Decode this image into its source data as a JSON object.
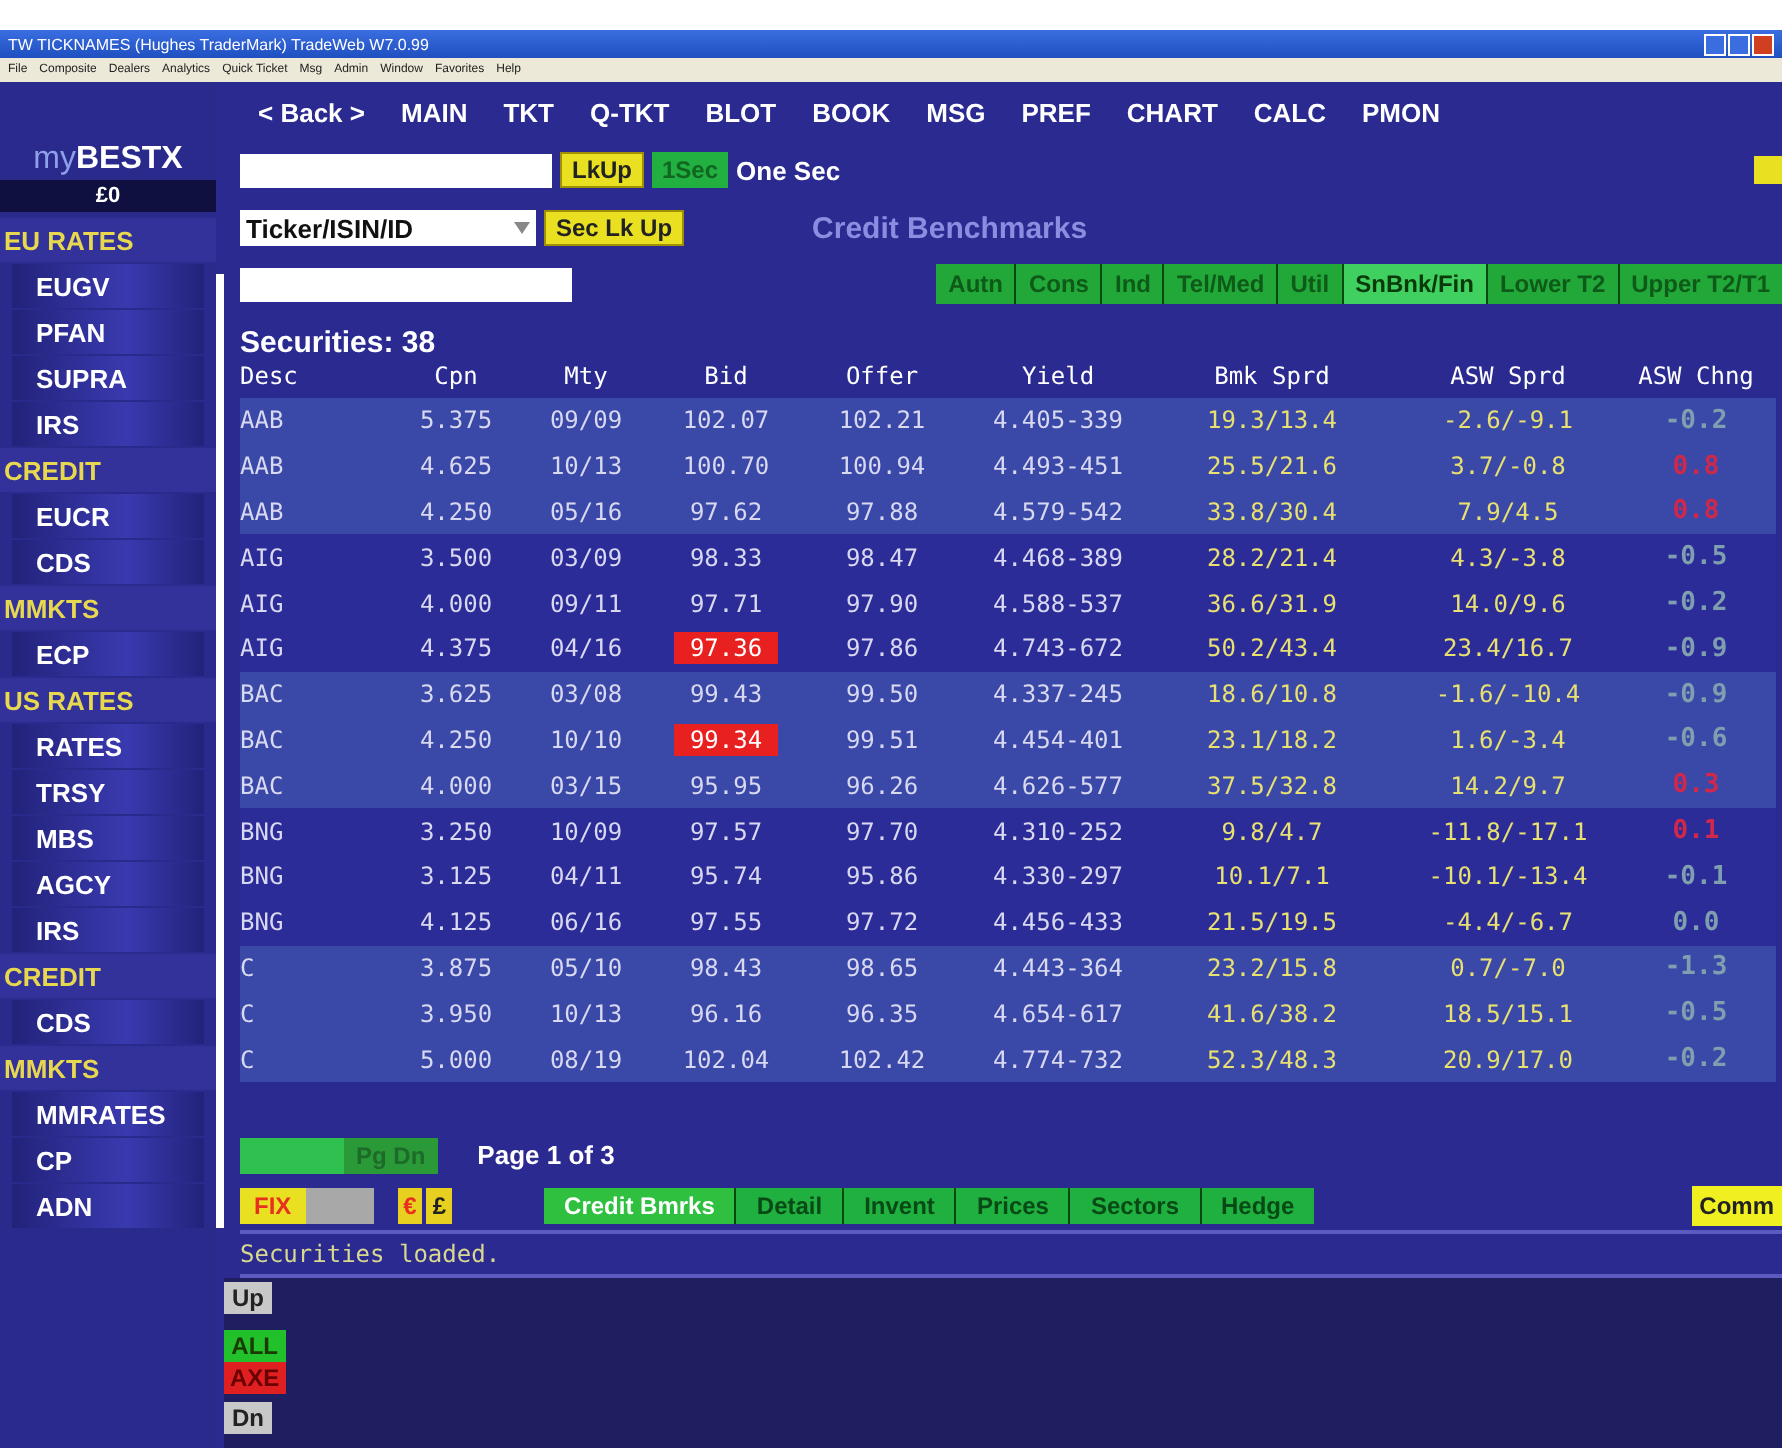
{
  "window": {
    "title": "TW TICKNAMES (Hughes TraderMark) TradeWeb W7.0.99",
    "menu": [
      "File",
      "Composite",
      "Dealers",
      "Analytics",
      "Quick Ticket",
      "Msg",
      "Admin",
      "Window",
      "Favorites",
      "Help"
    ]
  },
  "nav": [
    "< Back >",
    "MAIN",
    "TKT",
    "Q-TKT",
    "BLOT",
    "BOOK",
    "MSG",
    "PREF",
    "CHART",
    "CALC",
    "PMON"
  ],
  "brand": {
    "prefix": "my",
    "name": "BESTX",
    "balance": "£0"
  },
  "sidebar": [
    {
      "title": "EU RATES",
      "items": [
        "EUGV",
        "PFAN",
        "SUPRA",
        "IRS"
      ]
    },
    {
      "title": "CREDIT",
      "items": [
        "EUCR",
        "CDS"
      ]
    },
    {
      "title": "MMKTS",
      "items": [
        "ECP"
      ]
    },
    {
      "title": "US RATES",
      "items": [
        "RATES",
        "TRSY",
        "MBS",
        "AGCY",
        "IRS"
      ]
    },
    {
      "title": "CREDIT",
      "items": [
        "CDS"
      ]
    },
    {
      "title": "MMKTS",
      "items": [
        "MMRATES",
        "CP",
        "ADN"
      ]
    }
  ],
  "lookup": {
    "button": "LkUp",
    "toggle": "1Sec",
    "toggle_label": "One Sec"
  },
  "search": {
    "type_select": "Ticker/ISIN/ID",
    "button": "Sec Lk Up"
  },
  "panel_title": "Credit Benchmarks",
  "sector_tabs": [
    {
      "label": "Autn",
      "selected": false
    },
    {
      "label": "Cons",
      "selected": false
    },
    {
      "label": "Ind",
      "selected": false
    },
    {
      "label": "Tel/Med",
      "selected": false
    },
    {
      "label": "Util",
      "selected": false
    },
    {
      "label": "SnBnk/Fin",
      "selected": true
    },
    {
      "label": "Lower T2",
      "selected": false
    },
    {
      "label": "Upper T2/T1",
      "selected": false
    }
  ],
  "count": "Securities: 38",
  "table": {
    "columns": [
      "Desc",
      "Cpn",
      "Mty",
      "Bid",
      "Offer",
      "Yield",
      "Bmk Sprd",
      "ASW Sprd",
      "ASW Chng"
    ],
    "rows": [
      {
        "cells": [
          "AAB",
          "5.375",
          "09/09",
          "102.07",
          "102.21",
          "4.405-339",
          "19.3/13.4",
          "-2.6/-9.1",
          "-0.2"
        ],
        "shaded": true,
        "bid_alert": false,
        "color": "#7f9fb0"
      },
      {
        "cells": [
          "AAB",
          "4.625",
          "10/13",
          "100.70",
          "100.94",
          "4.493-451",
          "25.5/21.6",
          "3.7/-0.8",
          "0.8"
        ],
        "shaded": true,
        "bid_alert": false,
        "color": "#d0284a"
      },
      {
        "cells": [
          "AAB",
          "4.250",
          "05/16",
          "97.62",
          "97.88",
          "4.579-542",
          "33.8/30.4",
          "7.9/4.5",
          "0.8"
        ],
        "shaded": true,
        "bid_alert": false,
        "color": "#d0284a"
      },
      {
        "cells": [
          "AIG",
          "3.500",
          "03/09",
          "98.33",
          "98.47",
          "4.468-389",
          "28.2/21.4",
          "4.3/-3.8",
          "-0.5"
        ],
        "shaded": false,
        "bid_alert": false,
        "color": "#7f9fb0"
      },
      {
        "cells": [
          "AIG",
          "4.000",
          "09/11",
          "97.71",
          "97.90",
          "4.588-537",
          "36.6/31.9",
          "14.0/9.6",
          "-0.2"
        ],
        "shaded": false,
        "bid_alert": false,
        "color": "#7f9fb0"
      },
      {
        "cells": [
          "AIG",
          "4.375",
          "04/16",
          "97.36",
          "97.86",
          "4.743-672",
          "50.2/43.4",
          "23.4/16.7",
          "-0.9"
        ],
        "shaded": false,
        "bid_alert": true,
        "color": "#7f9fb0"
      },
      {
        "cells": [
          "BAC",
          "3.625",
          "03/08",
          "99.43",
          "99.50",
          "4.337-245",
          "18.6/10.8",
          "-1.6/-10.4",
          "-0.9"
        ],
        "shaded": true,
        "bid_alert": false,
        "color": "#7f9fb0"
      },
      {
        "cells": [
          "BAC",
          "4.250",
          "10/10",
          "99.34",
          "99.51",
          "4.454-401",
          "23.1/18.2",
          "1.6/-3.4",
          "-0.6"
        ],
        "shaded": true,
        "bid_alert": true,
        "color": "#7f9fb0"
      },
      {
        "cells": [
          "BAC",
          "4.000",
          "03/15",
          "95.95",
          "96.26",
          "4.626-577",
          "37.5/32.8",
          "14.2/9.7",
          "0.3"
        ],
        "shaded": true,
        "bid_alert": false,
        "color": "#d0284a"
      },
      {
        "cells": [
          "BNG",
          "3.250",
          "10/09",
          "97.57",
          "97.70",
          "4.310-252",
          "9.8/4.7",
          "-11.8/-17.1",
          "0.1"
        ],
        "shaded": false,
        "bid_alert": false,
        "color": "#d0284a"
      },
      {
        "cells": [
          "BNG",
          "3.125",
          "04/11",
          "95.74",
          "95.86",
          "4.330-297",
          "10.1/7.1",
          "-10.1/-13.4",
          "-0.1"
        ],
        "shaded": false,
        "bid_alert": false,
        "color": "#7f9fb0"
      },
      {
        "cells": [
          "BNG",
          "4.125",
          "06/16",
          "97.55",
          "97.72",
          "4.456-433",
          "21.5/19.5",
          "-4.4/-6.7",
          "0.0"
        ],
        "shaded": false,
        "bid_alert": false,
        "color": "#7f9fb0"
      },
      {
        "cells": [
          "C",
          "3.875",
          "05/10",
          "98.43",
          "98.65",
          "4.443-364",
          "23.2/15.8",
          "0.7/-7.0",
          "-1.3"
        ],
        "shaded": true,
        "bid_alert": false,
        "color": "#7f9fb0"
      },
      {
        "cells": [
          "C",
          "3.950",
          "10/13",
          "96.16",
          "96.35",
          "4.654-617",
          "41.6/38.2",
          "18.5/15.1",
          "-0.5"
        ],
        "shaded": true,
        "bid_alert": false,
        "color": "#7f9fb0"
      },
      {
        "cells": [
          "C",
          "5.000",
          "08/19",
          "102.04",
          "102.42",
          "4.774-732",
          "52.3/48.3",
          "20.9/17.0",
          "-0.2"
        ],
        "shaded": true,
        "bid_alert": false,
        "color": "#7f9fb0"
      }
    ]
  },
  "pager": {
    "next": "Pg Dn",
    "page": "Page 1 of 3"
  },
  "toolbar": {
    "fix": "FIX",
    "currencies": [
      "€",
      "£"
    ],
    "views": [
      {
        "label": "Credit Bmrks",
        "selected": true
      },
      {
        "label": "Detail",
        "selected": false
      },
      {
        "label": "Invent",
        "selected": false
      },
      {
        "label": "Prices",
        "selected": false
      },
      {
        "label": "Sectors",
        "selected": false
      },
      {
        "label": "Hedge",
        "selected": false
      }
    ],
    "comm": "Comm"
  },
  "status": "Securities loaded.",
  "side_controls": {
    "up": "Up",
    "filters": [
      {
        "label": "ALL",
        "color": "#22c02a"
      },
      {
        "label": "AXE",
        "color": "#e02020"
      }
    ],
    "down": "Dn"
  }
}
